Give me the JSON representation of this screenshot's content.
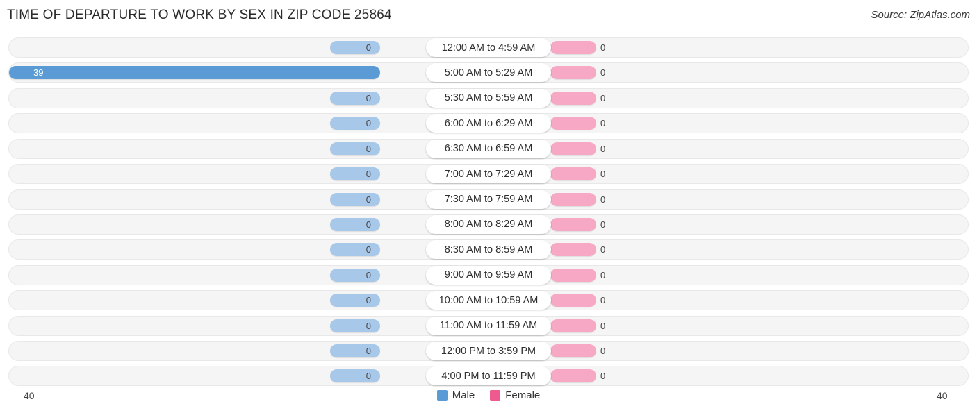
{
  "header": {
    "title": "TIME OF DEPARTURE TO WORK BY SEX IN ZIP CODE 25864",
    "source": "Source: ZipAtlas.com"
  },
  "axis": {
    "left_label": "40",
    "right_label": "40"
  },
  "legend": {
    "items": [
      {
        "label": "Male",
        "color": "#5b9bd5",
        "icon": "square-swatch-icon"
      },
      {
        "label": "Female",
        "color": "#ee5a8f",
        "icon": "square-swatch-icon"
      }
    ]
  },
  "chart_data": {
    "type": "bar",
    "orientation": "horizontal-diverging",
    "title": "TIME OF DEPARTURE TO WORK BY SEX IN ZIP CODE 25864",
    "xlabel": "",
    "ylabel": "",
    "xlim": [
      40,
      40
    ],
    "axis_max_left": 40,
    "axis_max_right": 40,
    "grid": true,
    "legend_position": "bottom-center",
    "categories": [
      "12:00 AM to 4:59 AM",
      "5:00 AM to 5:29 AM",
      "5:30 AM to 5:59 AM",
      "6:00 AM to 6:29 AM",
      "6:30 AM to 6:59 AM",
      "7:00 AM to 7:29 AM",
      "7:30 AM to 7:59 AM",
      "8:00 AM to 8:29 AM",
      "8:30 AM to 8:59 AM",
      "9:00 AM to 9:59 AM",
      "10:00 AM to 10:59 AM",
      "11:00 AM to 11:59 AM",
      "12:00 PM to 3:59 PM",
      "4:00 PM to 11:59 PM"
    ],
    "series": [
      {
        "name": "Male",
        "color": "#5b9bd5",
        "zero_color": "#a8c8ea",
        "values": [
          0,
          39,
          0,
          0,
          0,
          0,
          0,
          0,
          0,
          0,
          0,
          0,
          0,
          0
        ]
      },
      {
        "name": "Female",
        "color": "#ee5a8f",
        "zero_color": "#f7a8c4",
        "values": [
          0,
          0,
          0,
          0,
          0,
          0,
          0,
          0,
          0,
          0,
          0,
          0,
          0,
          0
        ]
      }
    ]
  }
}
